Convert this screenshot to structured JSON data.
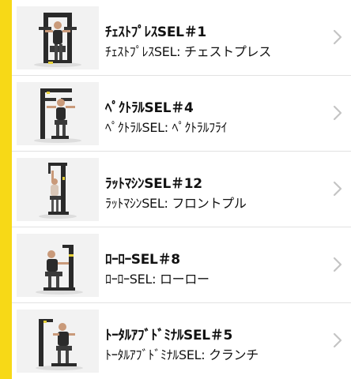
{
  "theme": {
    "accent": "#f7d917",
    "chevron_color": "#c4c4c4",
    "divider_color": "#e2e2e2"
  },
  "machines": [
    {
      "title": "ﾁｪｽﾄﾌﾟﾚｽSEL＃1",
      "subtitle": "ﾁｪｽﾄﾌﾟﾚｽSEL: チェストプレス",
      "image_icon": "chest-press-machine-image"
    },
    {
      "title": "ﾍﾟｸﾄﾗﾙSEL＃4",
      "subtitle": "ﾍﾟｸﾄﾗﾙSEL: ﾍﾟｸﾄﾗﾙﾌﾗｲ",
      "image_icon": "pectoral-machine-image"
    },
    {
      "title": "ﾗｯﾄﾏｼﾝSEL＃12",
      "subtitle": "ﾗｯﾄﾏｼﾝSEL: フロントプル",
      "image_icon": "lat-machine-image"
    },
    {
      "title": "ﾛｰﾛｰSEL＃8",
      "subtitle": "ﾛｰﾛｰSEL: ローロー",
      "image_icon": "low-row-machine-image"
    },
    {
      "title": "ﾄｰﾀﾙｱﾌﾞﾄﾞﾐﾅﾙSEL＃5",
      "subtitle": "ﾄｰﾀﾙｱﾌﾞﾄﾞﾐﾅﾙSEL: クランチ",
      "image_icon": "total-abdominal-machine-image"
    }
  ]
}
